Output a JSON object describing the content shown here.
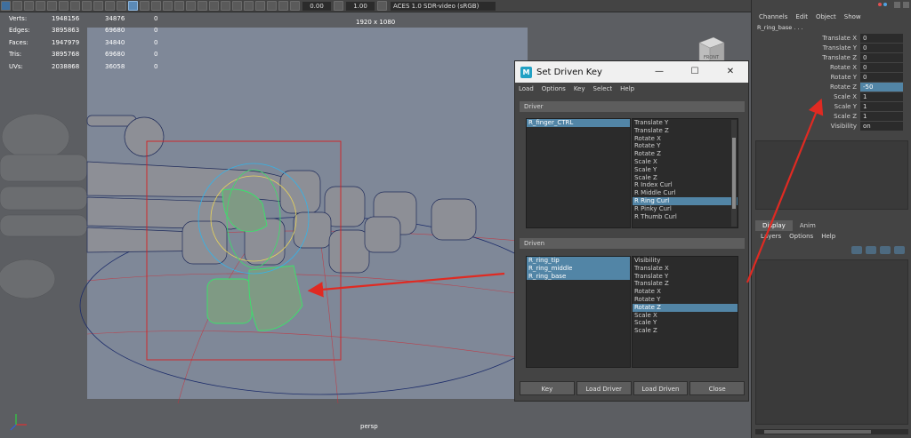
{
  "toolbar": {
    "value_a": "0.00",
    "value_b": "1.00",
    "colorspace": "ACES 1.0 SDR-video (sRGB)"
  },
  "viewport": {
    "hud": [
      {
        "label": "Verts:",
        "a": "1948156",
        "b": "34876",
        "c": "0"
      },
      {
        "label": "Edges:",
        "a": "3895863",
        "b": "69680",
        "c": "0"
      },
      {
        "label": "Faces:",
        "a": "1947979",
        "b": "34840",
        "c": "0"
      },
      {
        "label": "Tris:",
        "a": "3895768",
        "b": "69680",
        "c": "0"
      },
      {
        "label": "UVs:",
        "a": "2038868",
        "b": "36058",
        "c": "0"
      }
    ],
    "resolution": "1920 x 1080",
    "camera": "persp",
    "viewcube_label": "FRONT"
  },
  "dialog": {
    "title": "Set Driven Key",
    "menu": [
      "Load",
      "Options",
      "Key",
      "Select",
      "Help"
    ],
    "driver_header": "Driver",
    "driver_objects": [
      "R_finger_CTRL"
    ],
    "driver_attrs": [
      "Translate Y",
      "Translate Z",
      "Rotate X",
      "Rotate Y",
      "Rotate Z",
      "Scale X",
      "Scale Y",
      "Scale Z",
      "R Index Curl",
      "R Middle Curl",
      "R Ring Curl",
      "R Pinky Curl",
      "R Thumb Curl"
    ],
    "driver_attr_selected": "R Ring Curl",
    "driven_header": "Driven",
    "driven_objects": [
      "R_ring_tip",
      "R_ring_middle",
      "R_ring_base"
    ],
    "driven_attrs": [
      "Visibility",
      "Translate X",
      "Translate Y",
      "Translate Z",
      "Rotate X",
      "Rotate Y",
      "Rotate Z",
      "Scale X",
      "Scale Y",
      "Scale Z"
    ],
    "driven_attr_selected": "Rotate Z",
    "buttons": {
      "key": "Key",
      "load_driver": "Load Driver",
      "load_driven": "Load Driven",
      "close": "Close"
    }
  },
  "channel_box": {
    "menu": [
      "Channels",
      "Edit",
      "Object",
      "Show"
    ],
    "object_name": "R_ring_base . . .",
    "attributes": [
      {
        "name": "Translate X",
        "value": "0"
      },
      {
        "name": "Translate Y",
        "value": "0"
      },
      {
        "name": "Translate Z",
        "value": "0"
      },
      {
        "name": "Rotate X",
        "value": "0"
      },
      {
        "name": "Rotate Y",
        "value": "0"
      },
      {
        "name": "Rotate Z",
        "value": "-50"
      },
      {
        "name": "Scale X",
        "value": "1"
      },
      {
        "name": "Scale Y",
        "value": "1"
      },
      {
        "name": "Scale Z",
        "value": "1"
      },
      {
        "name": "Visibility",
        "value": "on"
      }
    ],
    "selected_attribute": "Rotate Z",
    "layer_tabs": [
      "Display",
      "Anim"
    ],
    "layer_menu": [
      "Layers",
      "Options",
      "Help"
    ]
  },
  "colors": {
    "selection": "#5285a6",
    "annotation_arrow": "#e02a22",
    "gate_frame": "#d82020",
    "selected_mesh": "#39e36b"
  }
}
